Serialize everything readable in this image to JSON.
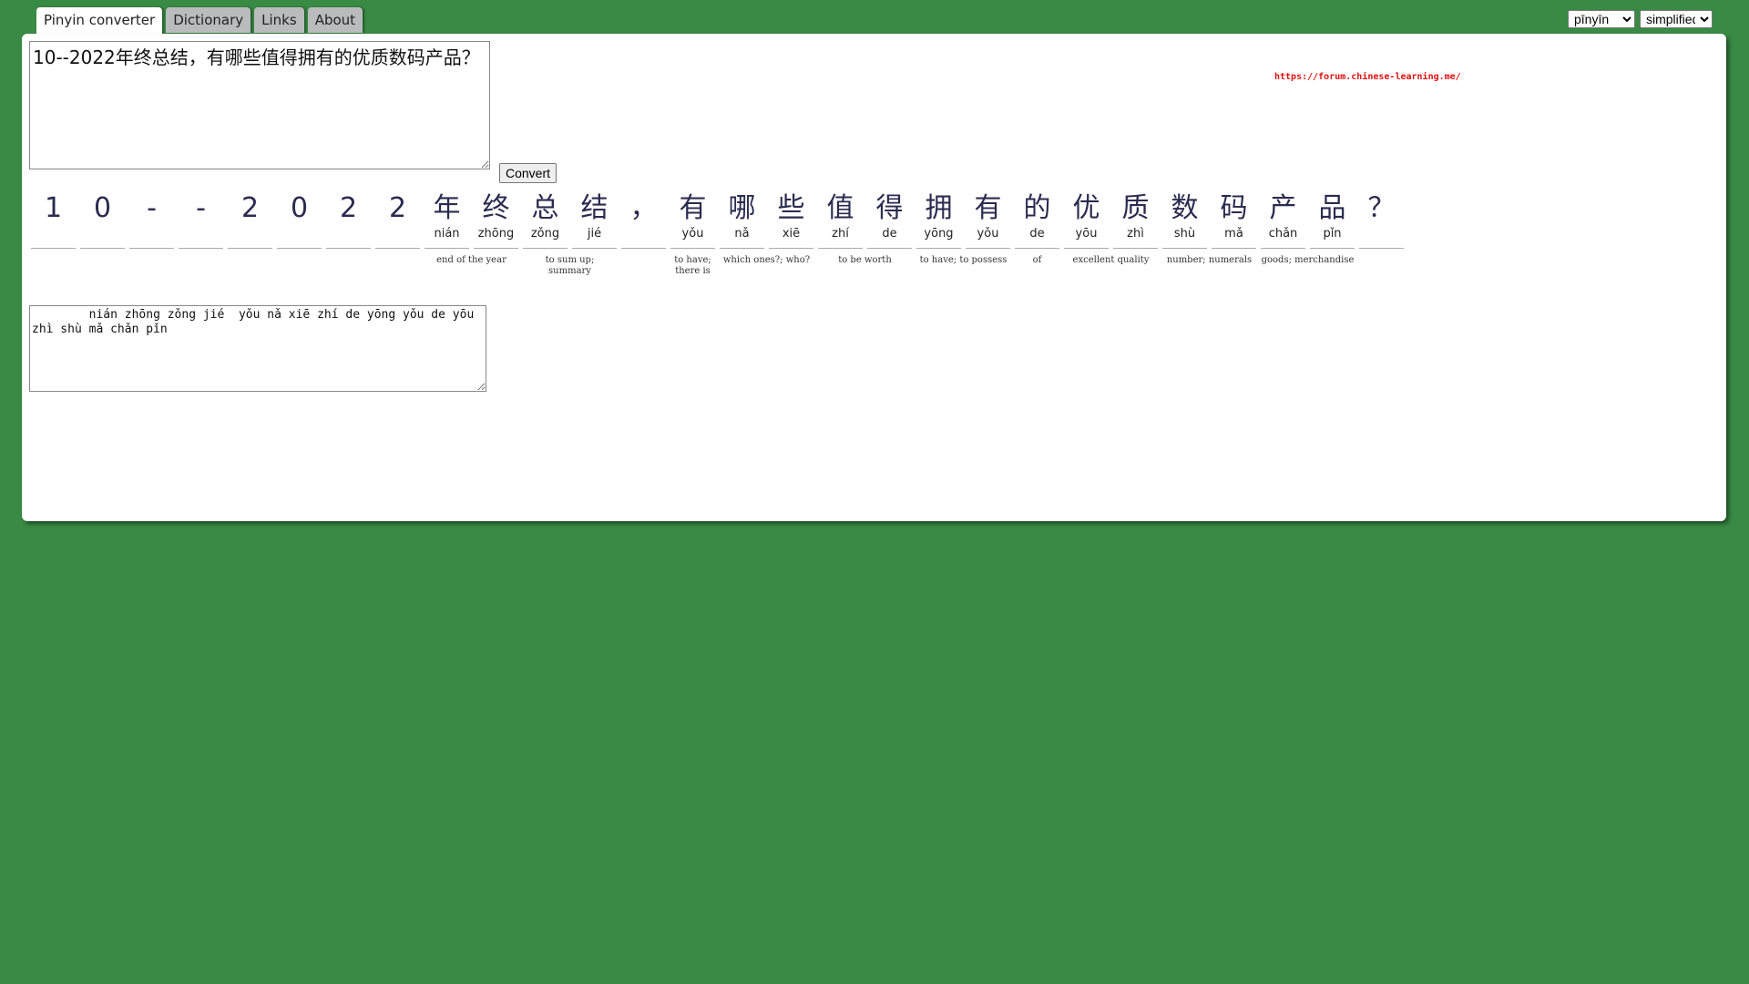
{
  "tabs": [
    "Pinyin converter",
    "Dictionary",
    "Links",
    "About"
  ],
  "controls": {
    "mode_selected": "pīnyīn",
    "script_selected": "simplified",
    "convert_label": "Convert"
  },
  "input_text": "10--2022年终总结，有哪些值得拥有的优质数码产品？",
  "forum_link": "https://forum.chinese-learning.me/",
  "characters": [
    {
      "han": "1",
      "py": ""
    },
    {
      "han": "0",
      "py": ""
    },
    {
      "han": "-",
      "py": ""
    },
    {
      "han": "-",
      "py": ""
    },
    {
      "han": "2",
      "py": ""
    },
    {
      "han": "0",
      "py": ""
    },
    {
      "han": "2",
      "py": ""
    },
    {
      "han": "2",
      "py": ""
    },
    {
      "han": "年",
      "py": "nián"
    },
    {
      "han": "终",
      "py": "zhōng"
    },
    {
      "han": "总",
      "py": "zǒng"
    },
    {
      "han": "结",
      "py": "jié"
    },
    {
      "han": "，",
      "py": ""
    },
    {
      "han": "有",
      "py": "yǒu"
    },
    {
      "han": "哪",
      "py": "nǎ"
    },
    {
      "han": "些",
      "py": "xiē"
    },
    {
      "han": "值",
      "py": "zhí"
    },
    {
      "han": "得",
      "py": "de"
    },
    {
      "han": "拥",
      "py": "yōng"
    },
    {
      "han": "有",
      "py": "yǒu"
    },
    {
      "han": "的",
      "py": "de"
    },
    {
      "han": "优",
      "py": "yōu"
    },
    {
      "han": "质",
      "py": "zhì"
    },
    {
      "han": "数",
      "py": "shù"
    },
    {
      "han": "码",
      "py": "mǎ"
    },
    {
      "han": "产",
      "py": "chǎn"
    },
    {
      "han": "品",
      "py": "pǐn"
    },
    {
      "han": "？",
      "py": ""
    }
  ],
  "glosses": [
    {
      "start": 8,
      "span": 2,
      "text": "end of the year"
    },
    {
      "start": 10,
      "span": 2,
      "text": "to sum up; summary"
    },
    {
      "start": 13,
      "span": 1,
      "text": "to have; there is"
    },
    {
      "start": 14,
      "span": 2,
      "text": "which ones?; who?"
    },
    {
      "start": 16,
      "span": 2,
      "text": "to be worth"
    },
    {
      "start": 18,
      "span": 2,
      "text": "to have; to possess"
    },
    {
      "start": 20,
      "span": 1,
      "text": "of"
    },
    {
      "start": 21,
      "span": 2,
      "text": "excellent quality"
    },
    {
      "start": 23,
      "span": 2,
      "text": "number; numerals"
    },
    {
      "start": 25,
      "span": 2,
      "text": "goods; merchandise"
    }
  ],
  "output_text": "        nián zhōng zǒng jié  yǒu nǎ xiē zhí de yōng yǒu de yōu zhì shù mǎ chǎn pǐn"
}
